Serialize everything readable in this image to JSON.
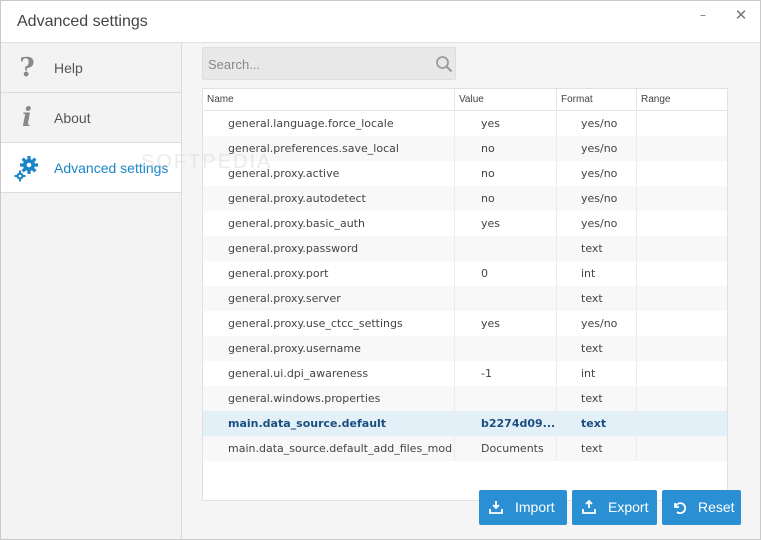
{
  "window": {
    "title": "Advanced settings",
    "minimize_glyph": "–",
    "close_glyph": "✕"
  },
  "sidebar": {
    "items": [
      {
        "label": "Help",
        "icon": "question-icon",
        "active": false
      },
      {
        "label": "About",
        "icon": "info-icon",
        "active": false
      },
      {
        "label": "Advanced settings",
        "icon": "gears-icon",
        "active": true
      }
    ]
  },
  "search": {
    "placeholder": "Search..."
  },
  "table": {
    "columns": {
      "name": "Name",
      "value": "Value",
      "format": "Format",
      "range": "Range"
    },
    "rows": [
      {
        "name": "general.language.force_locale",
        "value": "yes",
        "format": "yes/no",
        "range": ""
      },
      {
        "name": "general.preferences.save_local",
        "value": "no",
        "format": "yes/no",
        "range": ""
      },
      {
        "name": "general.proxy.active",
        "value": "no",
        "format": "yes/no",
        "range": ""
      },
      {
        "name": "general.proxy.autodetect",
        "value": "no",
        "format": "yes/no",
        "range": ""
      },
      {
        "name": "general.proxy.basic_auth",
        "value": "yes",
        "format": "yes/no",
        "range": ""
      },
      {
        "name": "general.proxy.password",
        "value": "",
        "format": "text",
        "range": ""
      },
      {
        "name": "general.proxy.port",
        "value": "0",
        "format": "int",
        "range": ""
      },
      {
        "name": "general.proxy.server",
        "value": "",
        "format": "text",
        "range": ""
      },
      {
        "name": "general.proxy.use_ctcc_settings",
        "value": "yes",
        "format": "yes/no",
        "range": ""
      },
      {
        "name": "general.proxy.username",
        "value": "",
        "format": "text",
        "range": ""
      },
      {
        "name": "general.ui.dpi_awareness",
        "value": "-1",
        "format": "int",
        "range": ""
      },
      {
        "name": "general.windows.properties",
        "value": "",
        "format": "text",
        "range": ""
      },
      {
        "name": "main.data_source.default",
        "value": "b2274d09...",
        "format": "text",
        "range": "",
        "selected": true
      },
      {
        "name": "main.data_source.default_add_files_mod",
        "value": "Documents",
        "format": "text",
        "range": ""
      }
    ]
  },
  "buttons": {
    "import": "Import",
    "export": "Export",
    "reset": "Reset"
  },
  "watermark": "SOFTPEDIA",
  "colors": {
    "accent": "#2a8fd3",
    "active_sidebar_text": "#1a86c8",
    "selected_row": "#e4f0f8"
  }
}
